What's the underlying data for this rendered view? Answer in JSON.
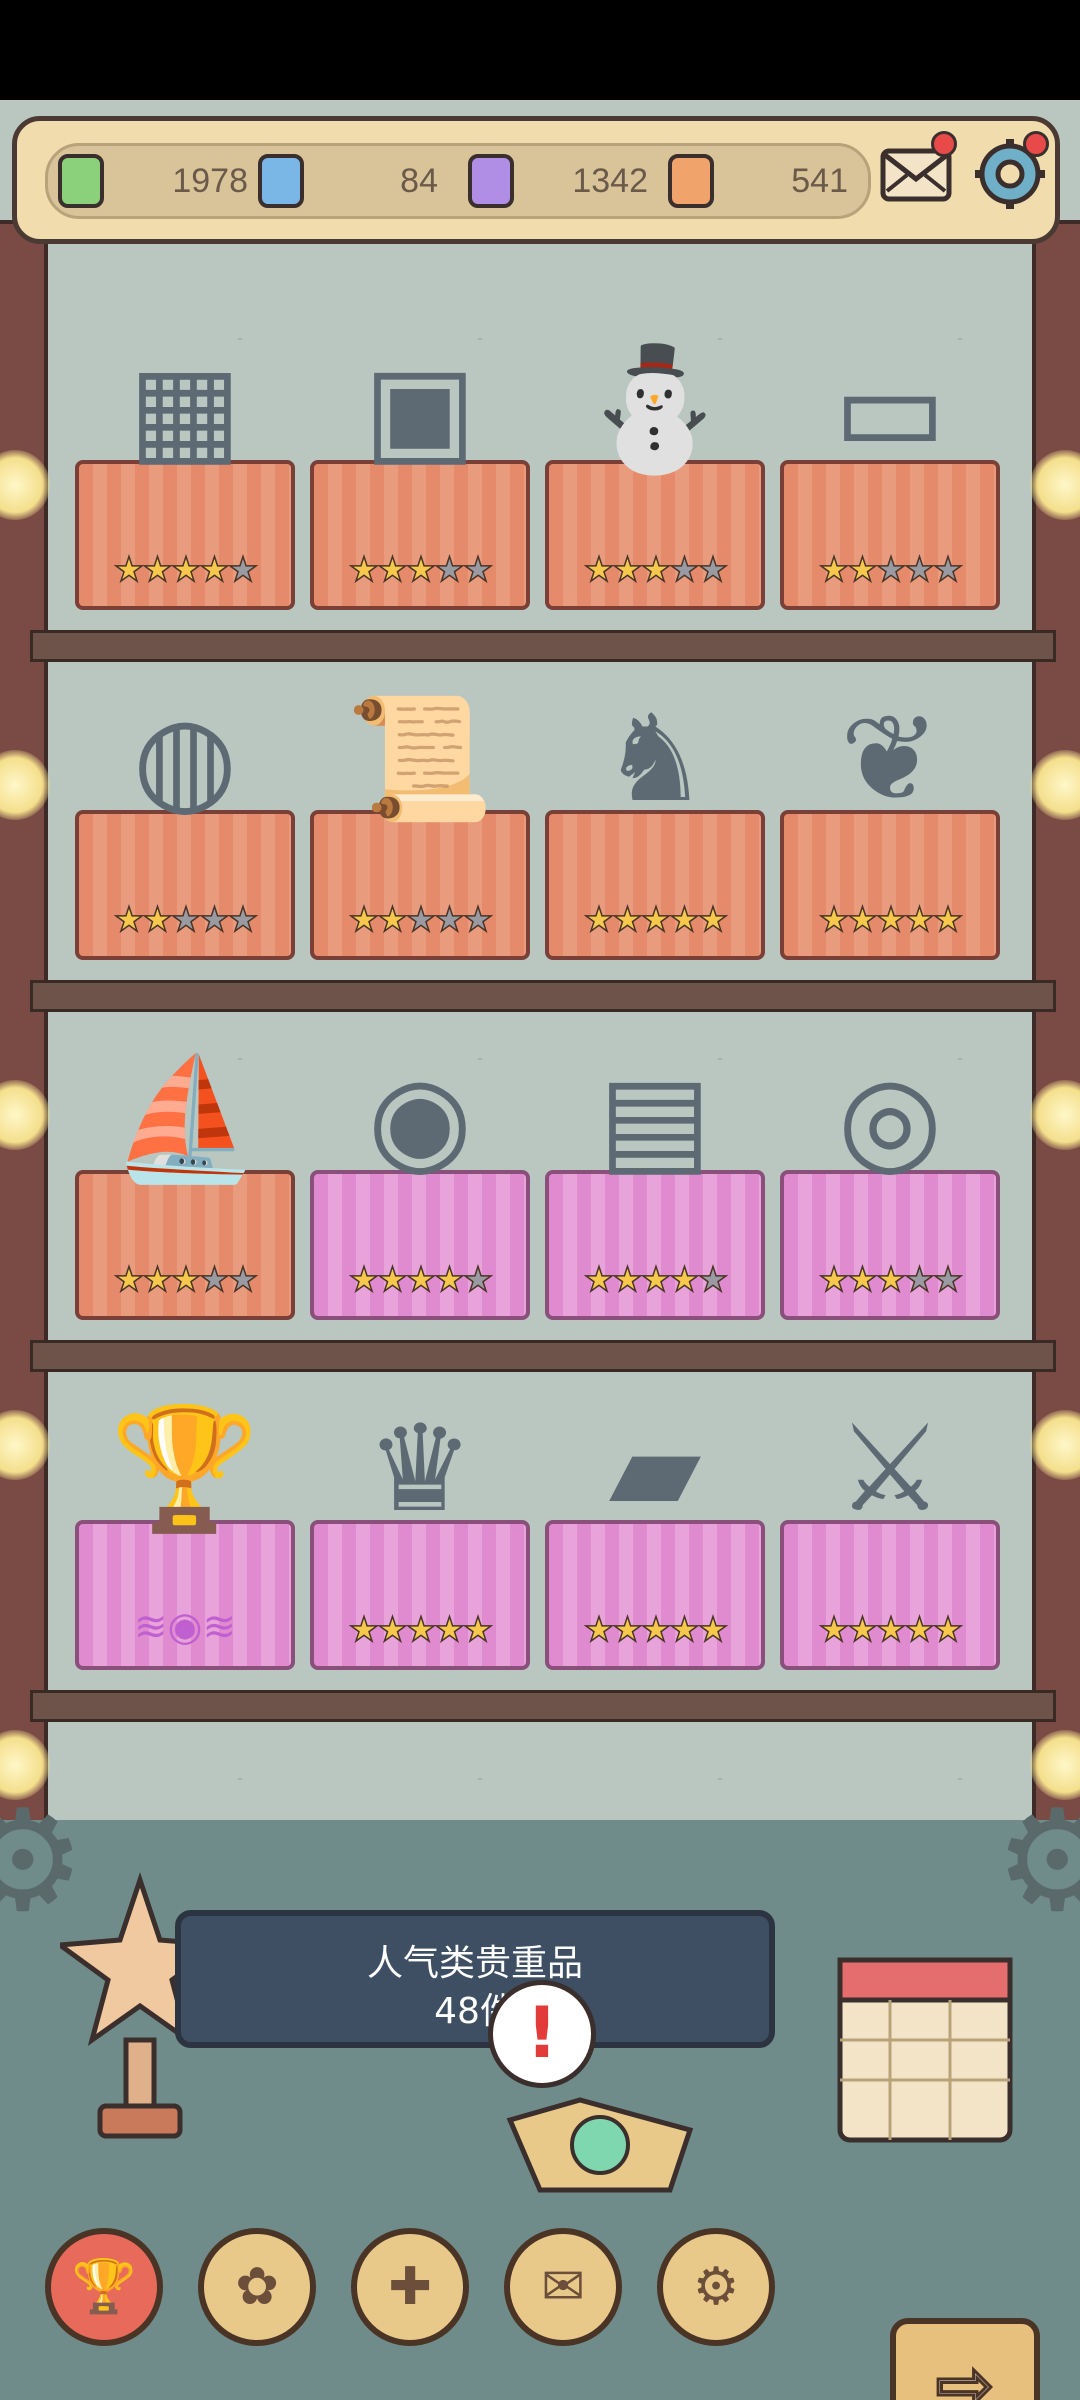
{
  "resources": [
    {
      "name": "green-ink-bottle-icon",
      "value": "1978",
      "color": "#8bd07a"
    },
    {
      "name": "blue-ink-bottle-icon",
      "value": "84",
      "color": "#7ab6e6"
    },
    {
      "name": "purple-ink-bottle-icon",
      "value": "1342",
      "color": "#b08ee6"
    },
    {
      "name": "orange-ink-bottle-icon",
      "value": "541",
      "color": "#f0a36a"
    }
  ],
  "top_icons": {
    "mail": "mail-icon",
    "settings": "settings-gear-icon"
  },
  "shelves": [
    {
      "items": [
        {
          "name": "rubiks-cube",
          "cloth": "orange",
          "stars": 4,
          "glyph": "▦"
        },
        {
          "name": "arcade-machine",
          "cloth": "orange",
          "stars": 3,
          "glyph": "▣"
        },
        {
          "name": "statue-globe",
          "cloth": "orange",
          "stars": 3,
          "glyph": "⛄"
        },
        {
          "name": "stone-tablet-sign",
          "cloth": "orange",
          "stars": 2,
          "glyph": "▭"
        }
      ]
    },
    {
      "items": [
        {
          "name": "globe-on-stand",
          "cloth": "orange",
          "stars": 2,
          "glyph": "◍"
        },
        {
          "name": "declaration-document",
          "cloth": "orange",
          "stars": 2,
          "glyph": "📜"
        },
        {
          "name": "ice-dragon-statue",
          "cloth": "orange",
          "stars": 5,
          "glyph": "♞"
        },
        {
          "name": "green-leaf",
          "cloth": "orange",
          "stars": 5,
          "glyph": "❦"
        }
      ]
    },
    {
      "items": [
        {
          "name": "sailing-ships",
          "cloth": "orange",
          "stars": 3,
          "glyph": "⛵"
        },
        {
          "name": "portrait-coin",
          "cloth": "pink",
          "stars": 4,
          "glyph": "◉"
        },
        {
          "name": "framed-portrait",
          "cloth": "pink",
          "stars": 4,
          "glyph": "▤"
        },
        {
          "name": "twisted-ring",
          "cloth": "pink",
          "stars": 3,
          "glyph": "◎"
        }
      ]
    },
    {
      "items": [
        {
          "name": "goblet-in-bell-jar",
          "cloth": "pink",
          "stars": 0,
          "special": "wings",
          "glyph": "🏆"
        },
        {
          "name": "world-cup-trophy",
          "cloth": "pink",
          "stars": 5,
          "glyph": "♛"
        },
        {
          "name": "rosetta-stone",
          "cloth": "pink",
          "stars": 5,
          "glyph": "▰"
        },
        {
          "name": "sword-throne",
          "cloth": "pink",
          "stars": 5,
          "glyph": "⚔"
        }
      ]
    }
  ],
  "plaque": {
    "line1": "人气类贵重品",
    "line2": "48件"
  },
  "alert": "!",
  "bottom_nav": [
    {
      "name": "trophy-tab",
      "glyph": "🏆",
      "active": true
    },
    {
      "name": "rose-tab",
      "glyph": "✿",
      "active": false
    },
    {
      "name": "puzzle-tab",
      "glyph": "✚",
      "active": false
    },
    {
      "name": "scroll-tab",
      "glyph": "✉",
      "active": false
    },
    {
      "name": "gear-tab",
      "glyph": "⚙",
      "active": false
    }
  ],
  "next_arrow": "⇨"
}
